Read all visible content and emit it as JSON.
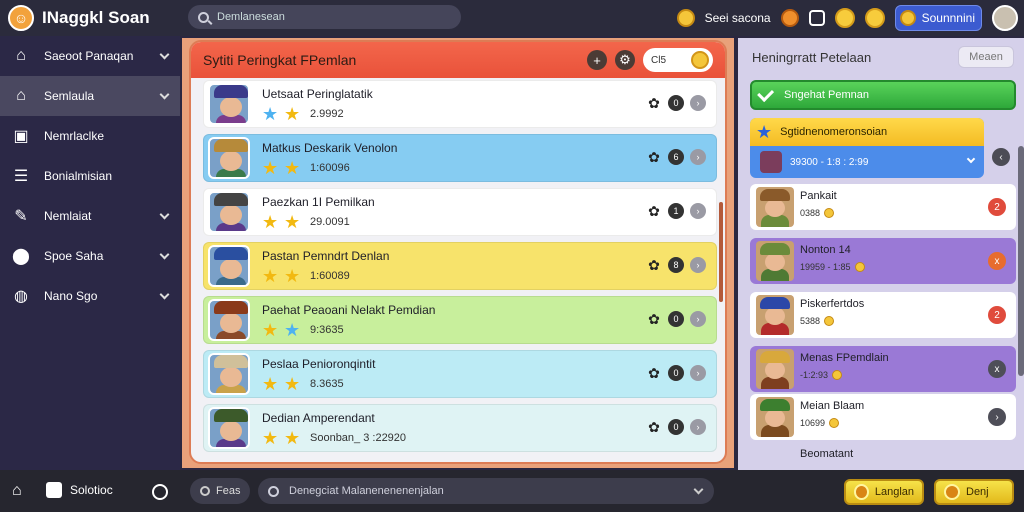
{
  "app": {
    "title": "INaggkl Soan"
  },
  "topbar": {
    "search_value": "Demlanesean",
    "coins_label": "Seei sacona",
    "profile_label": "Sounnnini"
  },
  "sidebar": {
    "items": [
      {
        "label": "Saeoot Panaqan",
        "icon": "home-icon",
        "has_chevron": true,
        "active": false
      },
      {
        "label": "Semlaula",
        "icon": "house-icon",
        "has_chevron": true,
        "active": true
      },
      {
        "label": "Nemrlaclke",
        "icon": "briefcase-icon",
        "has_chevron": false,
        "active": false
      },
      {
        "label": "Bonialmisian",
        "icon": "list-icon",
        "has_chevron": false,
        "active": false
      },
      {
        "label": "Nemlaiat",
        "icon": "pin-icon",
        "has_chevron": true,
        "active": false
      },
      {
        "label": "Spoe Saha",
        "icon": "pin-drop-icon",
        "has_chevron": true,
        "active": false
      },
      {
        "label": "Nano Sgo",
        "icon": "globe-icon",
        "has_chevron": true,
        "active": false
      }
    ]
  },
  "main": {
    "title": "Sytiti Peringkat FPemlan",
    "header_pill_label": "Cl5",
    "rows": [
      {
        "name": "Uetsaat Peringlatatik",
        "score": "2.9992",
        "color": "#ffffff",
        "stars": [
          "blue",
          "gold"
        ],
        "badge": "0"
      },
      {
        "name": "Matkus Deskarik Venolon",
        "score": "1:60096",
        "color": "#86ccf2",
        "stars": [
          "gold",
          "gold"
        ],
        "badge": "6"
      },
      {
        "name": "Paezkan 1I Pemilkan",
        "score": "29.0091",
        "color": "#ffffff",
        "stars": [
          "gold",
          "gold"
        ],
        "badge": "1"
      },
      {
        "name": "Pastan Pemndrt Denlan",
        "score": "1:60089",
        "color": "#f7e36b",
        "stars": [
          "gold",
          "gold"
        ],
        "badge": "8"
      },
      {
        "name": "Paehat Peaoani Nelakt Pemdian",
        "score": "9:3635",
        "color": "#c8ef9c",
        "stars": [
          "gold",
          "blue"
        ],
        "badge": "0"
      },
      {
        "name": "Peslaa Penioronqintit",
        "score": "8.3635",
        "color": "#bcebf5",
        "stars": [
          "gold",
          "gold"
        ],
        "badge": "0"
      },
      {
        "name": "Dedian Amperendant",
        "score": "Soonban_ 3 :22920",
        "color": "#dff3f4",
        "stars": [
          "gold",
          "gold"
        ],
        "badge": "0"
      }
    ]
  },
  "right": {
    "title": "Heningrratt Petelaan",
    "more_label": "Meaen",
    "green_button": "Sngehat Pemnan",
    "featured": {
      "title": "Sgtidnenomeronsoian",
      "score": "39300 - 1:8  : 2:99"
    },
    "friends": [
      {
        "name": "Pankait",
        "score": "0388",
        "color": "#ffffff",
        "act_color": "#e04b3c",
        "hat": "#8a5a2a",
        "body": "#6b8b3a",
        "act": "2"
      },
      {
        "name": "Nonton 14",
        "score": "19959 - 1:85",
        "color": "#9a79d6",
        "act_color": "#e76c2e",
        "hat": "#6b8b3a",
        "body": "#4f7a34",
        "act": "x"
      },
      {
        "name": "Piskerfertdos",
        "score": "5388",
        "color": "#ffffff",
        "act_color": "#e04b3c",
        "hat": "#2c47a8",
        "body": "#b32b2b",
        "act": "2"
      },
      {
        "name": "Menas FPemdlain",
        "score": "-1:2:93",
        "color": "#9a79d6",
        "act_color": "#4e4e58",
        "hat": "#d8a83c",
        "body": "#7e3f1f",
        "act": "x"
      },
      {
        "name": "Meian Blaam",
        "score": "10699",
        "color": "#ffffff",
        "act_color": "#4e4e58",
        "hat": "#3c7f2f",
        "body": "#7c4b1f",
        "act": "›"
      }
    ],
    "footer_label": "Beomatant"
  },
  "bottombar": {
    "home_icon": "home-icon",
    "button_label": "Solotioc",
    "filter_label": "Feas",
    "search_value": "Denegciat Malanenenenenjalan",
    "yellow_btn_1": "Langlan",
    "yellow_btn_2": "Denj"
  }
}
